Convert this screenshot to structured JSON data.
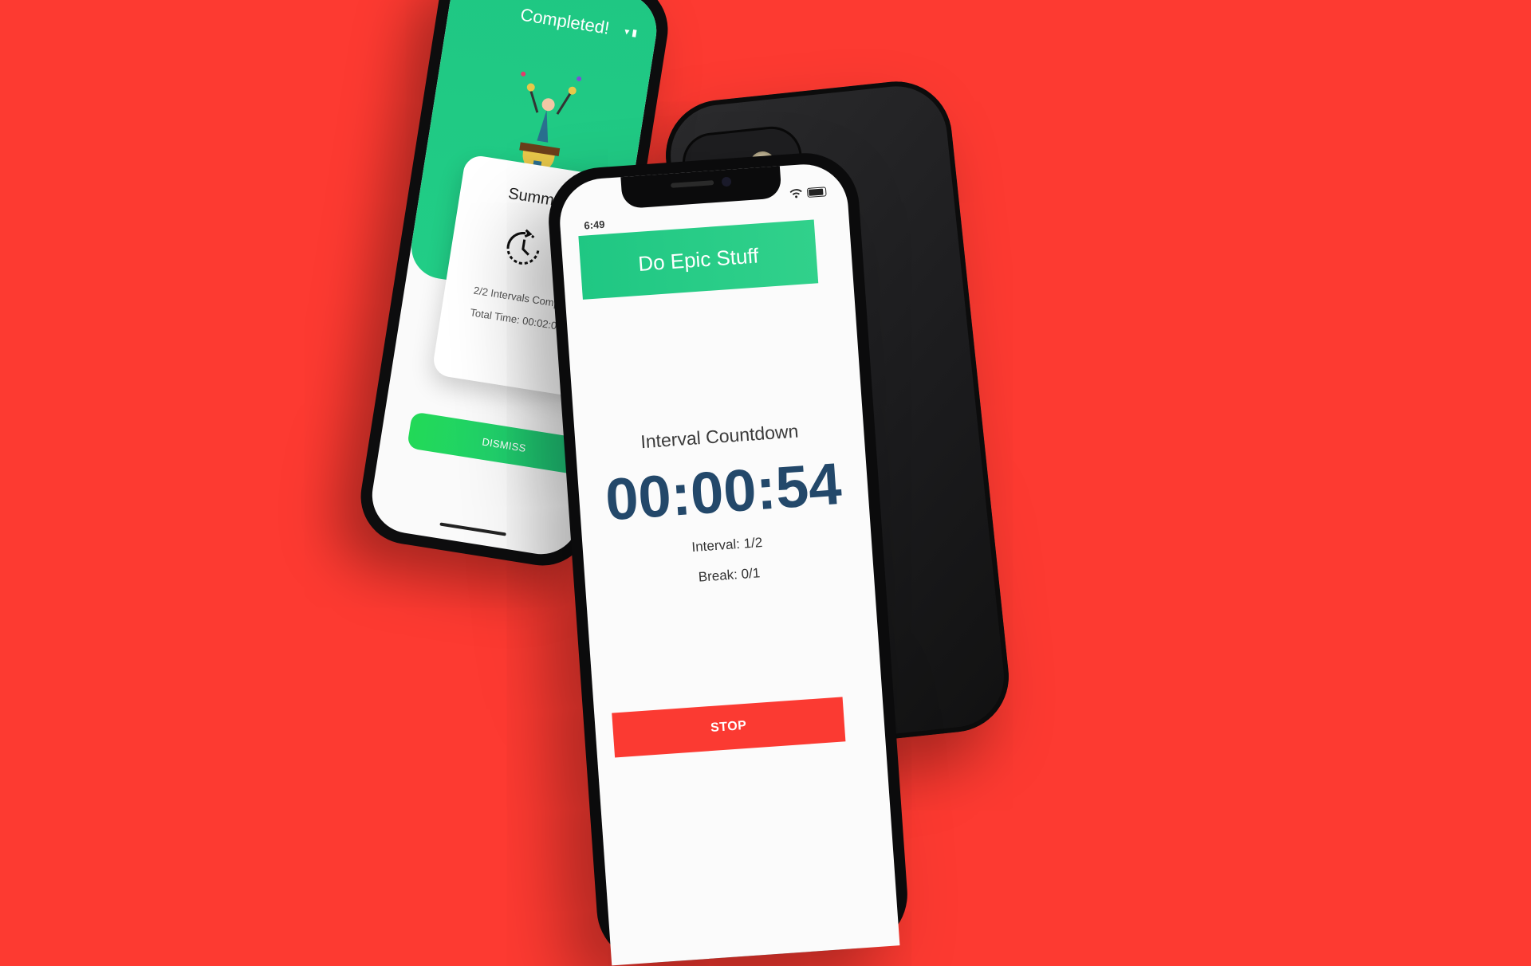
{
  "left_phone": {
    "title": "Completed!",
    "summary": {
      "title": "Summary",
      "intervals_completed": "2/2 Intervals Completed",
      "total_time": "Total Time: 00:02:05"
    },
    "dismiss_label": "DISMISS"
  },
  "front_phone": {
    "status_time": "6:49",
    "header_title": "Do Epic Stuff",
    "countdown_label": "Interval Countdown",
    "countdown_value": "00:00:54",
    "interval_text": "Interval: 1/2",
    "break_text": "Break: 0/1",
    "stop_label": "STOP"
  },
  "colors": {
    "background": "#fd3a31",
    "accent_green": "#1fc783",
    "timer_blue": "#23486a",
    "stop_red": "#fb3a32"
  }
}
